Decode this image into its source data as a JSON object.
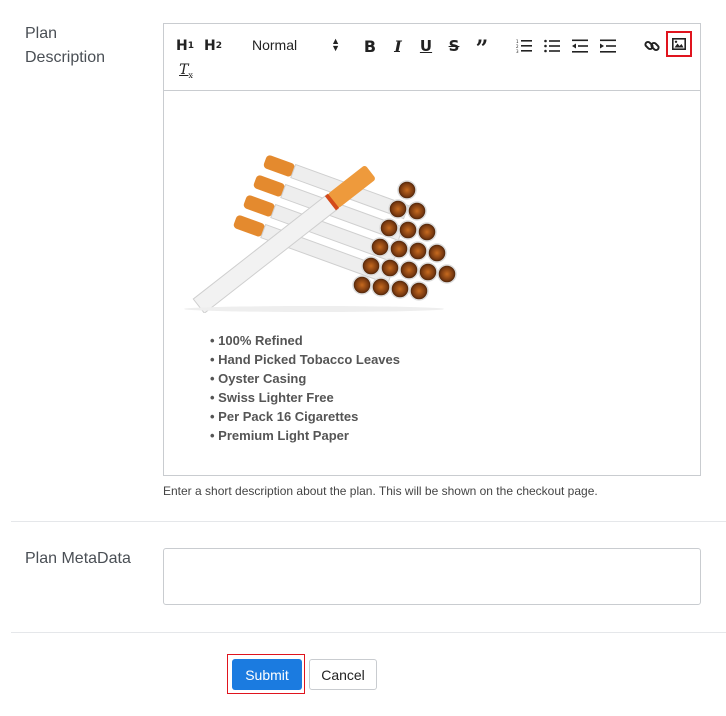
{
  "form": {
    "plan_description_label": "Plan\nDescription",
    "plan_description_help": "Enter a short description about the plan. This will be shown on the checkout page.",
    "plan_metadata_label": "Plan MetaData",
    "plan_metadata_value": "",
    "submit_label": "Submit",
    "cancel_label": "Cancel"
  },
  "toolbar": {
    "h1": "H",
    "h1_sub": "1",
    "h2": "H",
    "h2_sub": "2",
    "format_select": "Normal",
    "icons": [
      "bold-icon",
      "italic-icon",
      "underline-icon",
      "strike-icon",
      "blockquote-icon",
      "ordered-list-icon",
      "bullet-list-icon",
      "outdent-icon",
      "indent-icon",
      "link-icon",
      "image-icon",
      "clear-format-icon"
    ]
  },
  "editor_content": {
    "bullets": [
      "100% Refined",
      "Hand Picked Tobacco Leaves",
      "Oyster Casing",
      "Swiss Lighter Free",
      "Per Pack 16 Cigarettes",
      "Premium Light Paper"
    ]
  },
  "colors": {
    "primary": "#1b7be0",
    "highlight": "#e0141e"
  }
}
